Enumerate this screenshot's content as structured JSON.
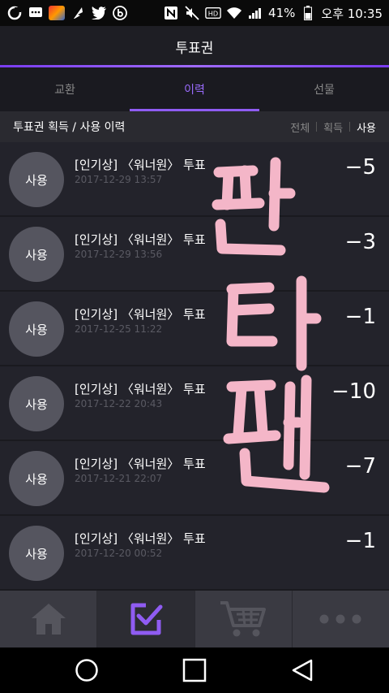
{
  "status_bar": {
    "battery": "41%",
    "time": "오후 10:35"
  },
  "header": {
    "title": "투표권"
  },
  "tabs": [
    {
      "label": "교환",
      "active": false
    },
    {
      "label": "이력",
      "active": true
    },
    {
      "label": "선물",
      "active": false
    }
  ],
  "history": {
    "label": "투표권 획득 / 사용 이력",
    "filters": [
      {
        "label": "전체",
        "active": false
      },
      {
        "label": "획득",
        "active": false
      },
      {
        "label": "사용",
        "active": true
      }
    ]
  },
  "items": [
    {
      "badge": "사용",
      "title": "[인기상] 〈워너원〉 투표",
      "date": "2017-12-29 13:57",
      "amount": "−5"
    },
    {
      "badge": "사용",
      "title": "[인기상] 〈워너원〉 투표",
      "date": "2017-12-29 13:56",
      "amount": "−3"
    },
    {
      "badge": "사용",
      "title": "[인기상] 〈워너원〉 투표",
      "date": "2017-12-25 11:22",
      "amount": "−1"
    },
    {
      "badge": "사용",
      "title": "[인기상] 〈워너원〉 투표",
      "date": "2017-12-22 20:43",
      "amount": "−10"
    },
    {
      "badge": "사용",
      "title": "[인기상] 〈워너원〉 투표",
      "date": "2017-12-21 22:07",
      "amount": "−7"
    },
    {
      "badge": "사용",
      "title": "[인기상] 〈워너원〉 투표",
      "date": "2017-12-20 00:52",
      "amount": "−1"
    }
  ],
  "overlay_text": "판타팬",
  "colors": {
    "accent": "#8f5cf2",
    "overlay_pink": "#f4b6c8",
    "background": "#23232b"
  },
  "bottom_nav": [
    {
      "icon": "home-icon",
      "active": false
    },
    {
      "icon": "vote-check-icon",
      "active": true
    },
    {
      "icon": "cart-icon",
      "active": false
    },
    {
      "icon": "more-icon",
      "active": false
    }
  ]
}
